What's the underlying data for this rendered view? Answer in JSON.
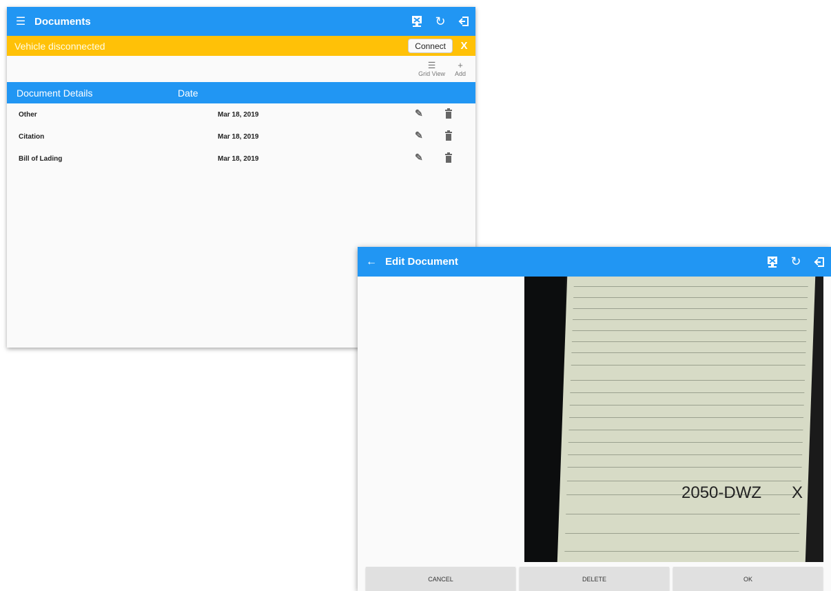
{
  "back_window": {
    "title": "Documents",
    "banner": {
      "message": "Vehicle disconnected",
      "connect_label": "Connect",
      "close_label": "X"
    },
    "toolbar": {
      "grid_view_label": "Grid View",
      "add_label": "Add"
    },
    "table": {
      "columns": [
        "Document Details",
        "Date"
      ],
      "rows": [
        {
          "name": "Other",
          "date": "Mar 18, 2019"
        },
        {
          "name": "Citation",
          "date": "Mar 18, 2019"
        },
        {
          "name": "Bill of Lading",
          "date": "Mar 18, 2019"
        }
      ]
    }
  },
  "front_window": {
    "title": "Edit Document",
    "image_text": {
      "plate": "2050-DWZ",
      "plate_x": "X"
    },
    "buttons": {
      "cancel": "CANCEL",
      "delete": "DELETE",
      "ok": "OK"
    }
  },
  "colors": {
    "primary": "#2196f3",
    "banner": "#ffc107"
  }
}
